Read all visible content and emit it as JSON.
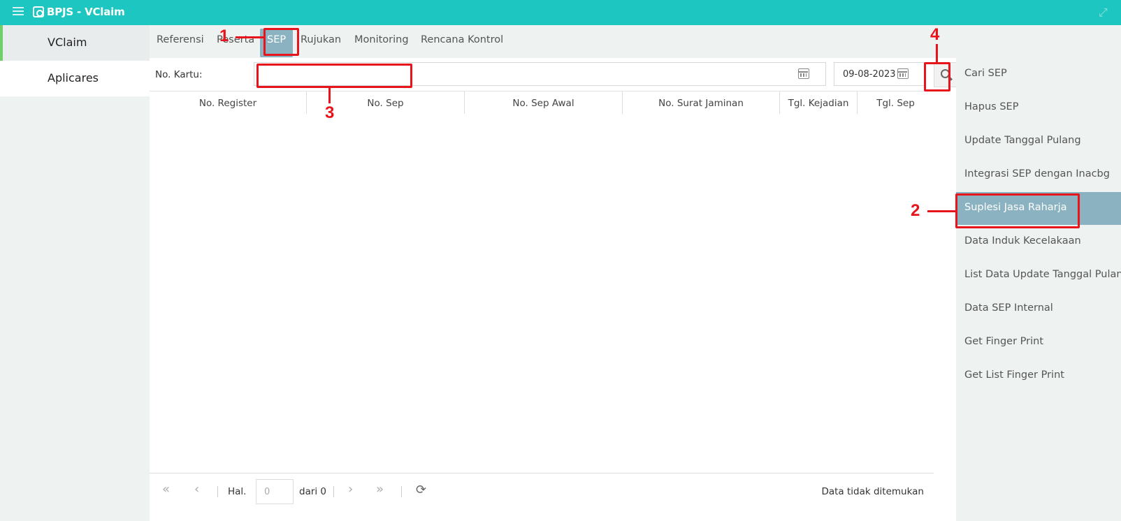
{
  "titlebar": {
    "title": "BPJS - VClaim"
  },
  "leftnav": {
    "items": [
      {
        "label": "VClaim"
      },
      {
        "label": "Aplicares"
      }
    ]
  },
  "topnav": {
    "tabs": [
      {
        "label": "Referensi"
      },
      {
        "label": "Peserta"
      },
      {
        "label": "SEP"
      },
      {
        "label": "Rujukan"
      },
      {
        "label": "Monitoring"
      },
      {
        "label": "Rencana Kontrol"
      }
    ],
    "active_tab": "SEP"
  },
  "search": {
    "label": "No. Kartu:",
    "card_value": "",
    "date_value": "09-08-2023"
  },
  "table": {
    "columns": [
      "No. Register",
      "No. Sep",
      "No. Sep Awal",
      "No. Surat Jaminan",
      "Tgl. Kejadian",
      "Tgl. Sep"
    ]
  },
  "pager": {
    "hal_label": "Hal.",
    "page_value": "0",
    "dari_label": "dari 0",
    "status": "Data tidak ditemukan"
  },
  "rightnav": {
    "items": [
      {
        "label": "Cari SEP"
      },
      {
        "label": "Hapus SEP"
      },
      {
        "label": "Update Tanggal Pulang"
      },
      {
        "label": "Integrasi SEP dengan Inacbg"
      },
      {
        "label": "Suplesi Jasa Raharja"
      },
      {
        "label": "Data Induk Kecelakaan"
      },
      {
        "label": "List Data Update Tanggal Pulang"
      },
      {
        "label": "Data SEP Internal"
      },
      {
        "label": "Get Finger Print"
      },
      {
        "label": "Get List Finger Print"
      }
    ],
    "active_item": "Suplesi Jasa Raharja"
  },
  "annotations": {
    "n1": "1",
    "n2": "2",
    "n3": "3",
    "n4": "4",
    "color": "#e8141c"
  },
  "colors": {
    "header": "#1dc6c0",
    "active": "#8ab2c0",
    "accent": "#6fd06a"
  }
}
